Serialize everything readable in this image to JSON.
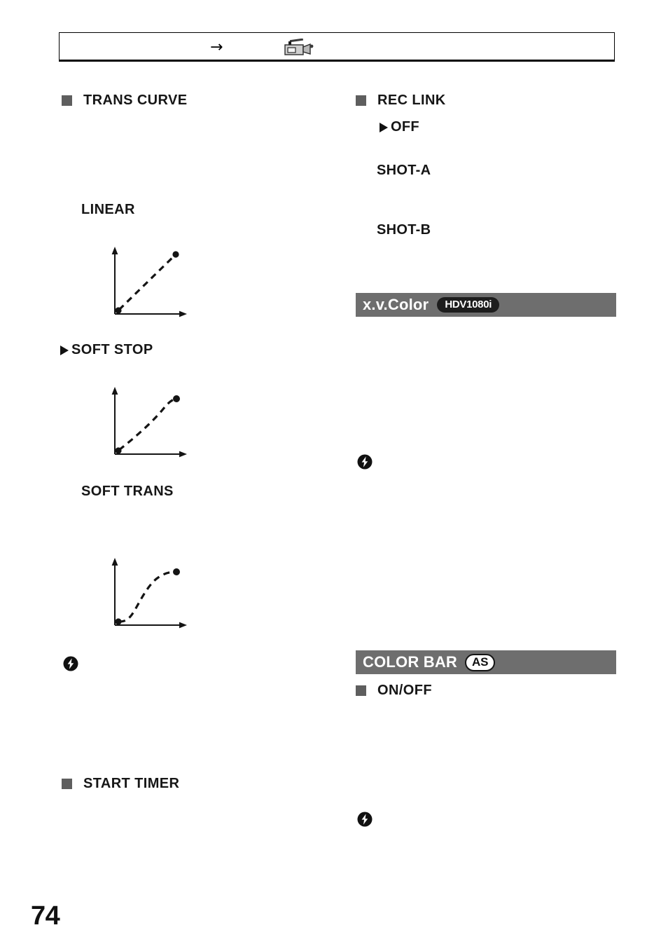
{
  "page": {
    "number": "74"
  },
  "header": {
    "arrow_glyph": "→",
    "camcorder_icon": "camcorder-icon"
  },
  "left_column": {
    "sections": [
      {
        "id": "trans-curve",
        "bullet": "square",
        "label": "TRANS CURVE",
        "options": [
          {
            "label": "LINEAR",
            "marker": "none",
            "figure": "linear-curve"
          },
          {
            "label": "SOFT STOP",
            "marker": "triangle",
            "figure": "soft-stop-curve"
          },
          {
            "label": "SOFT TRANS",
            "marker": "none",
            "figure": "soft-trans-curve"
          }
        ]
      },
      {
        "id": "start-timer",
        "bullet": "square",
        "label": "START TIMER",
        "options": []
      }
    ],
    "note_icon": "lightning-bolt-icon"
  },
  "right_column": {
    "sections": [
      {
        "id": "rec-link",
        "bullet": "square",
        "label": "REC LINK",
        "options": [
          {
            "label": "OFF",
            "marker": "triangle"
          },
          {
            "label": "SHOT-A",
            "marker": "none"
          },
          {
            "label": "SHOT-B",
            "marker": "none"
          }
        ]
      }
    ],
    "banners": [
      {
        "id": "xvcolor",
        "title": "x.v.Color",
        "badge": "HDV1080i",
        "badge_style": "dark"
      },
      {
        "id": "colorbar",
        "title": "COLOR BAR",
        "badge": "AS",
        "badge_style": "outline"
      }
    ],
    "colorbar_option": {
      "label": "ON/OFF",
      "bullet": "square"
    },
    "note_icons": [
      "lightning-bolt-icon",
      "lightning-bolt-icon"
    ]
  },
  "chart_data": [
    {
      "id": "linear-curve",
      "type": "line",
      "title": "LINEAR",
      "x": [
        0,
        1
      ],
      "y": [
        0,
        1
      ],
      "xlabel": "",
      "ylabel": "",
      "xlim": [
        0,
        1.15
      ],
      "ylim": [
        0,
        1.15
      ],
      "grid": false,
      "legend": "none",
      "style": "dashed",
      "endpoint_markers": true,
      "description": "Straight dashed diagonal line rising from lower-left dot to upper-right dot"
    },
    {
      "id": "soft-stop-curve",
      "type": "line",
      "title": "SOFT STOP",
      "x": [
        0,
        0.25,
        0.5,
        0.72,
        0.88,
        1
      ],
      "y": [
        0,
        0.26,
        0.52,
        0.72,
        0.83,
        0.85
      ],
      "xlabel": "",
      "ylabel": "",
      "xlim": [
        0,
        1.15
      ],
      "ylim": [
        0,
        1.15
      ],
      "grid": false,
      "legend": "none",
      "style": "dashed",
      "endpoint_markers": true,
      "description": "Dashed curve rising steadily then flattening near the top (ease-out)"
    },
    {
      "id": "soft-trans-curve",
      "type": "line",
      "title": "SOFT TRANS",
      "x": [
        0,
        0.12,
        0.3,
        0.5,
        0.7,
        0.86,
        1
      ],
      "y": [
        0,
        0.03,
        0.18,
        0.48,
        0.74,
        0.84,
        0.86
      ],
      "xlabel": "",
      "ylabel": "",
      "xlim": [
        0,
        1.15
      ],
      "ylim": [
        0,
        1.15
      ],
      "grid": false,
      "legend": "none",
      "style": "dashed",
      "endpoint_markers": true,
      "description": "Dashed S-shaped curve, flat at start, steep in middle, flat at end (ease-in-out)"
    }
  ]
}
